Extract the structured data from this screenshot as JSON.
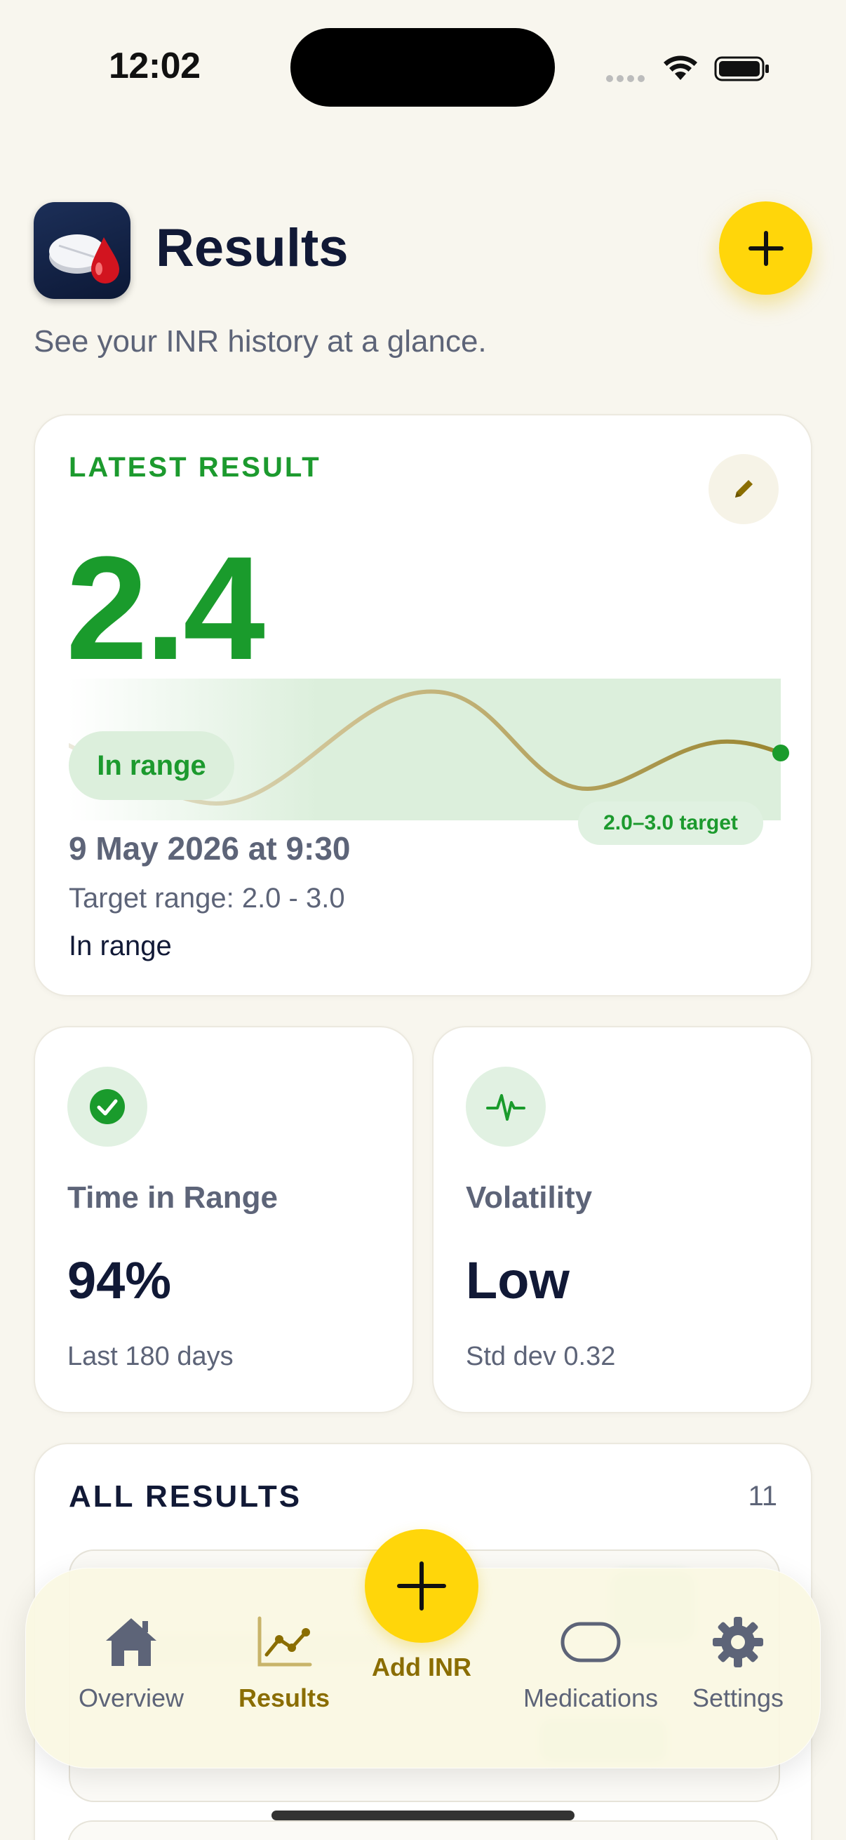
{
  "status_bar": {
    "time": "12:02"
  },
  "header": {
    "title": "Results",
    "subtitle": "See your INR history at a glance."
  },
  "latest_result": {
    "label": "LATEST RESULT",
    "value": "2.4",
    "status_pill": "In range",
    "target_chip": "2.0–3.0 target",
    "date": "9 May 2026 at 9:30",
    "target_range": "Target range: 2.0 - 3.0",
    "range_status": "In range"
  },
  "stats": {
    "time_in_range": {
      "title": "Time in Range",
      "value": "94%",
      "footer": "Last 180 days"
    },
    "volatility": {
      "title": "Volatility",
      "value": "Low",
      "footer": "Std dev 0.32"
    }
  },
  "all_results": {
    "label": "ALL RESULTS",
    "count": "11"
  },
  "tabbar": {
    "tabs": [
      {
        "label": "Overview",
        "icon": "house-icon"
      },
      {
        "label": "Results",
        "icon": "chart-line-icon",
        "active": true
      },
      {
        "label": "Add INR",
        "icon": "plus-icon"
      },
      {
        "label": "Medications",
        "icon": "pill-icon"
      },
      {
        "label": "Settings",
        "icon": "gear-icon"
      }
    ]
  },
  "colors": {
    "background": "#f8f6ee",
    "accent_yellow": "#ffd60a",
    "in_range_green": "#1a9b2c",
    "active_tab": "#8a6d00",
    "navy_text": "#111936"
  }
}
